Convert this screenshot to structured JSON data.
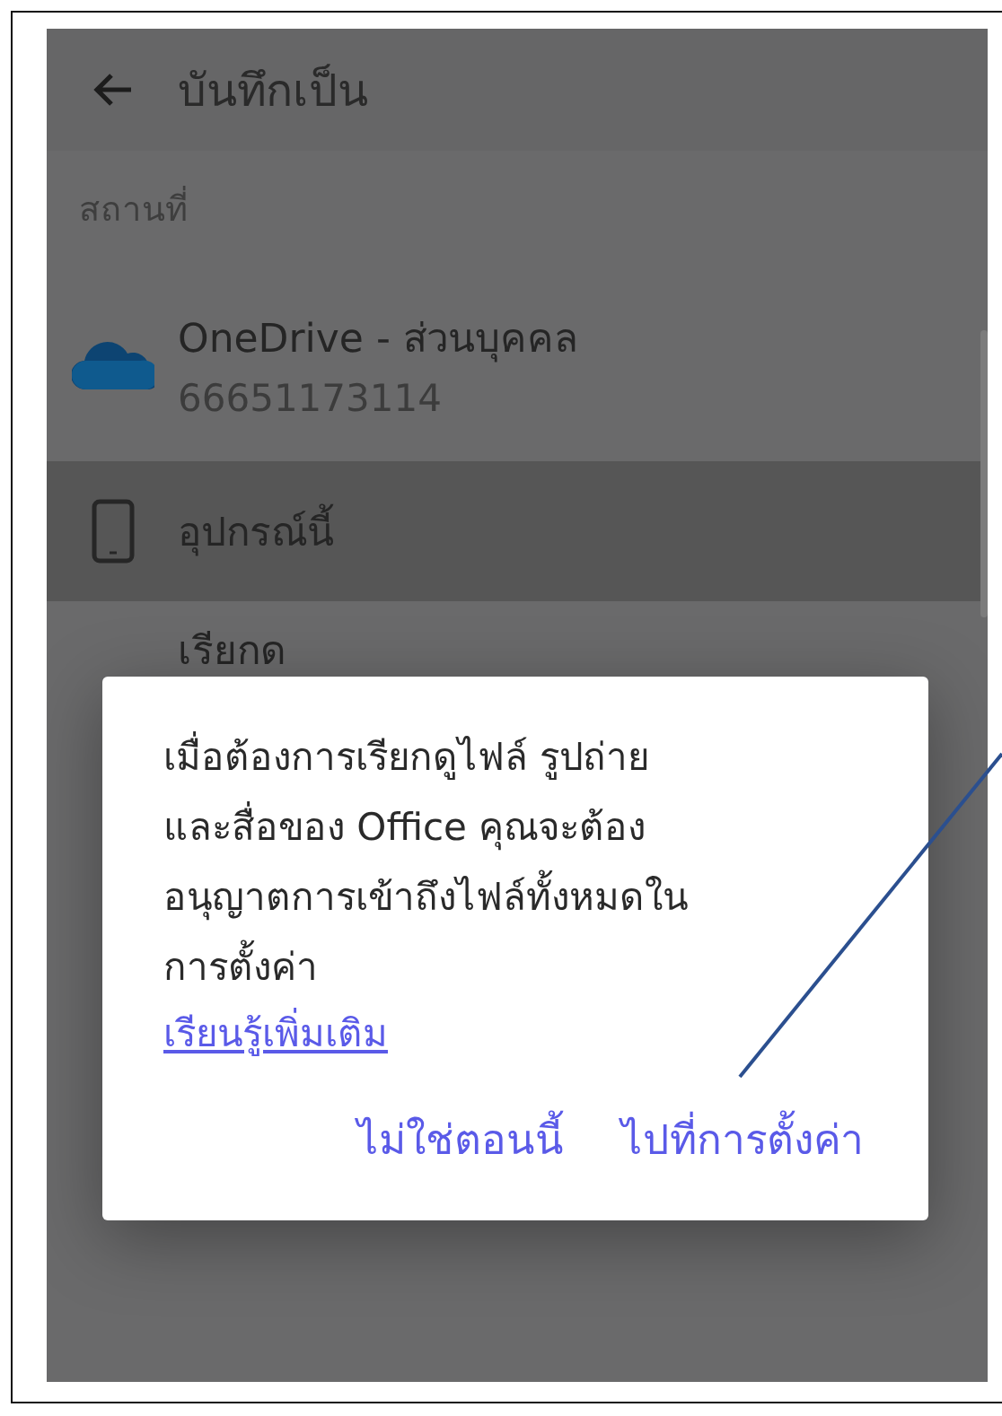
{
  "header": {
    "title": "บันทึกเป็น"
  },
  "section_label": "สถานที่",
  "locations": [
    {
      "kind": "cloud",
      "title": "OneDrive - ส่วนบุคคล",
      "subtitle": "66651173114",
      "selected": false
    },
    {
      "kind": "device",
      "title": "อุปกรณ์นี้",
      "selected": true
    },
    {
      "kind": "browse",
      "title": "เรียกด",
      "selected": false
    }
  ],
  "dialog": {
    "message": "เมื่อต้องการเรียกดูไฟล์ รูปถ่าย\nและสื่อของ Office คุณจะต้อง\nอนุญาตการเข้าถึงไฟล์ทั้งหมดใน\nการตั้งค่า",
    "link": "เรียนรู้เพิ่มเติม",
    "buttons": [
      "ไม่ใช่ตอนนี้",
      "ไปที่การตั้งค่า"
    ]
  }
}
